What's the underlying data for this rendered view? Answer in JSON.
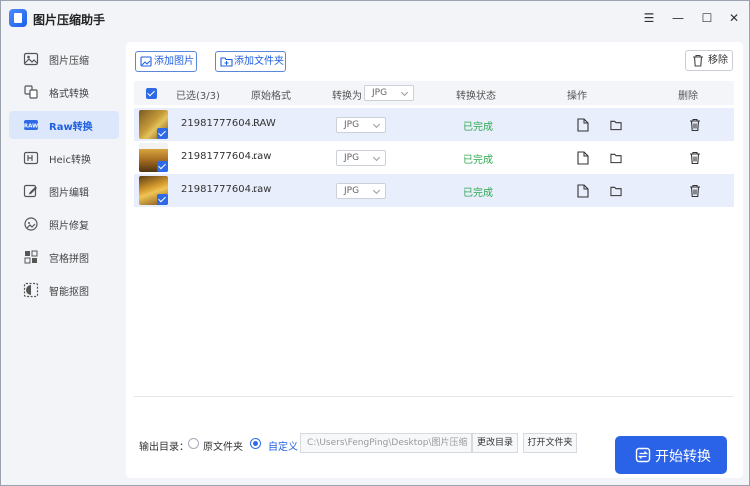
{
  "app": {
    "title": "图片压缩助手"
  },
  "window_controls": {
    "menu": "☰",
    "minimize": "—",
    "maximize": "☐",
    "close": "✕"
  },
  "sidebar": {
    "items": [
      {
        "label": "图片压缩",
        "icon": "image-compress-icon"
      },
      {
        "label": "格式转换",
        "icon": "format-convert-icon"
      },
      {
        "label": "Raw转换",
        "icon": "raw-convert-icon",
        "active": true
      },
      {
        "label": "Heic转换",
        "icon": "heic-convert-icon"
      },
      {
        "label": "图片编辑",
        "icon": "image-edit-icon"
      },
      {
        "label": "照片修复",
        "icon": "photo-repair-icon"
      },
      {
        "label": "宫格拼图",
        "icon": "grid-collage-icon"
      },
      {
        "label": "智能抠图",
        "icon": "smart-cutout-icon"
      }
    ]
  },
  "toolbar": {
    "add_image": "添加图片",
    "add_folder": "添加文件夹",
    "remove": "移除"
  },
  "table": {
    "headers": {
      "selected": "已选(3/3)",
      "original_format": "原始格式",
      "convert_to": "转换为",
      "convert_to_value": "JPG",
      "status": "转换状态",
      "actions": "操作",
      "delete": "删除"
    },
    "rows": [
      {
        "filename": "21981777604...",
        "format": "RAW",
        "target": "JPG",
        "status": "已完成"
      },
      {
        "filename": "21981777604...",
        "format": "raw",
        "target": "JPG",
        "status": "已完成"
      },
      {
        "filename": "21981777604...",
        "format": "raw",
        "target": "JPG",
        "status": "已完成"
      }
    ]
  },
  "output": {
    "label": "输出目录：",
    "option_original": "原文件夹",
    "option_custom": "自定义",
    "path": "C:\\Users\\FengPing\\Desktop\\图片压缩",
    "change_dir": "更改目录",
    "open_folder": "打开文件夹"
  },
  "start_button": "开始转换",
  "colors": {
    "accent": "#2b63e8",
    "status_done": "#2fa84f",
    "active_nav_bg": "#dde7fb"
  }
}
